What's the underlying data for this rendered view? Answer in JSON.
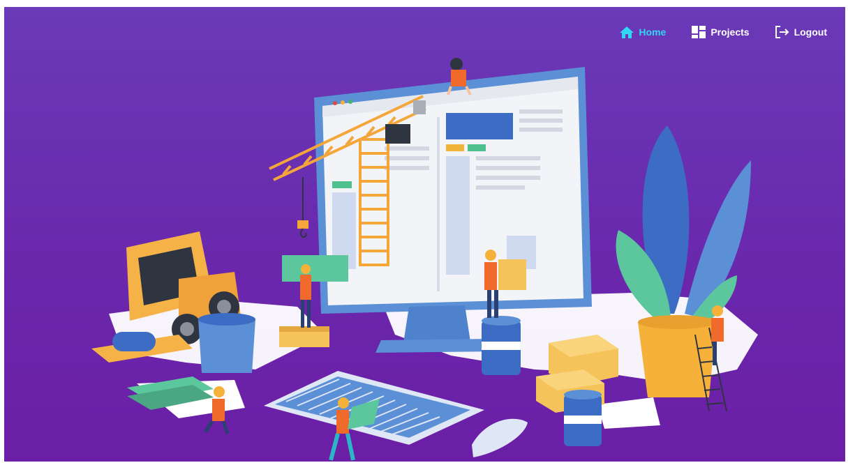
{
  "nav": {
    "items": [
      {
        "label": "Home",
        "icon": "home-icon",
        "active": true
      },
      {
        "label": "Projects",
        "icon": "dashboard-icon",
        "active": false
      },
      {
        "label": "Logout",
        "icon": "logout-icon",
        "active": false
      }
    ]
  },
  "colors": {
    "background_top": "#6a3ab8",
    "background_bottom": "#6b1ea6",
    "active_link": "#31d6f5",
    "link": "#ffffff"
  },
  "hero": {
    "illustration": "website-under-construction"
  }
}
